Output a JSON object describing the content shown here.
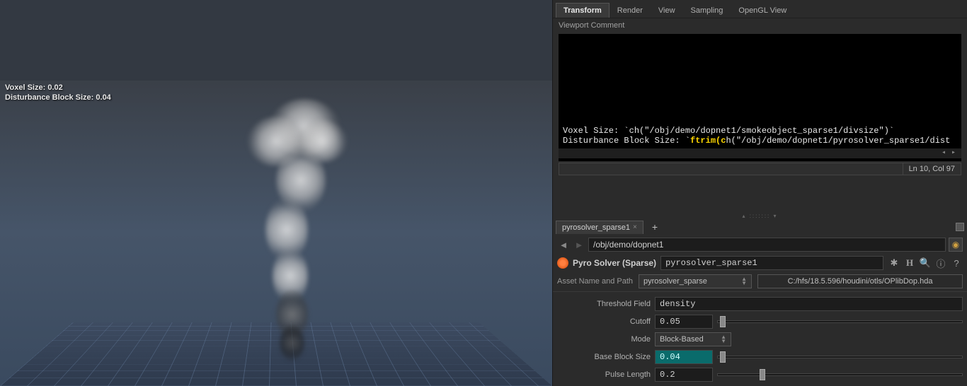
{
  "viewport": {
    "voxel_label": "Voxel Size:",
    "voxel_value": "0.02",
    "disturbance_label": "Disturbance Block Size:",
    "disturbance_value": "0.04"
  },
  "top_tabs": [
    {
      "label": "Transform",
      "active": true
    },
    {
      "label": "Render",
      "active": false
    },
    {
      "label": "View",
      "active": false
    },
    {
      "label": "Sampling",
      "active": false
    },
    {
      "label": "OpenGL View",
      "active": false
    }
  ],
  "comment_label": "Viewport Comment",
  "code": {
    "line1_pre": "Voxel Size: `",
    "line1_fn": "ch",
    "line1_post": "(\"/obj/demo/dopnet1/smokeobject_sparse1/divsize\")`",
    "line2_pre": "Disturbance Block Size: `",
    "line2_fn": "ftrim(c",
    "line2_post": "h(\"/obj/demo/dopnet1/pyrosolver_sparse1/dist"
  },
  "status": {
    "pos": "Ln 10, Col 97"
  },
  "node_tab": {
    "name": "pyrosolver_sparse1"
  },
  "nav": {
    "path": "/obj/demo/dopnet1"
  },
  "node": {
    "type": "Pyro Solver (Sparse)",
    "name": "pyrosolver_sparse1"
  },
  "asset": {
    "label": "Asset Name and Path",
    "name": "pyrosolver_sparse",
    "path": "C:/hfs/18.5.596/houdini/otls/OPlibDop.hda"
  },
  "params": {
    "threshold_label": "Threshold Field",
    "threshold_value": "density",
    "cutoff_label": "Cutoff",
    "cutoff_value": "0.05",
    "mode_label": "Mode",
    "mode_value": "Block-Based",
    "baseblock_label": "Base Block Size",
    "baseblock_value": "0.04",
    "pulse_label": "Pulse Length",
    "pulse_value": "0.2"
  }
}
